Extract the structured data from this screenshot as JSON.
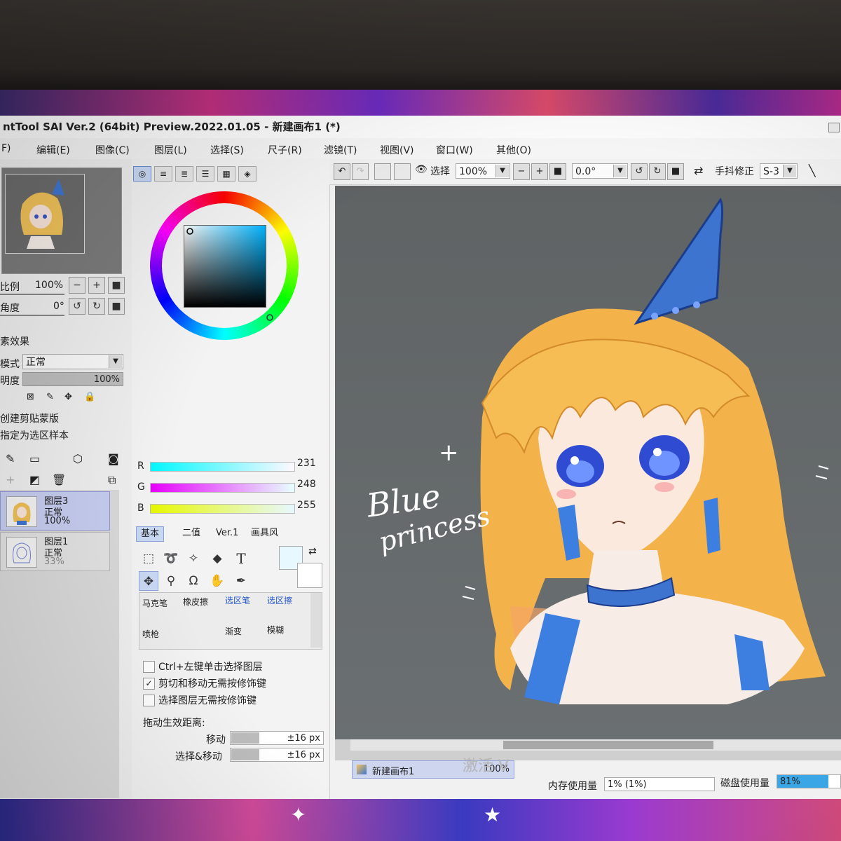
{
  "window": {
    "title": "ntTool SAI Ver.2 (64bit) Preview.2022.01.05 - 新建画布1 (*)"
  },
  "menu": [
    "F)",
    "编辑(E)",
    "图像(C)",
    "图层(L)",
    "选择(S)",
    "尺子(R)",
    "滤镜(T)",
    "视图(V)",
    "窗口(W)",
    "其他(O)"
  ],
  "navigator": {
    "scale_label": "比例",
    "scale_value": "100%",
    "angle_label": "角度",
    "angle_value": "0°"
  },
  "layer_panel": {
    "effect_label": "素效果",
    "mode_label": "模式",
    "mode_value": "正常",
    "opacity_label": "明度",
    "opacity_value": "100%",
    "opacity_fraction": 1.0,
    "clip_label": "创建剪贴蒙版",
    "selection_sample_label": "指定为选区样本",
    "layers": [
      {
        "name": "图层3",
        "mode": "正常",
        "opacity": "100%"
      },
      {
        "name": "图层1",
        "mode": "正常",
        "opacity": "33%"
      }
    ]
  },
  "color": {
    "r_label": "R",
    "g_label": "G",
    "b_label": "B",
    "r_value": "231",
    "g_value": "248",
    "b_value": "255",
    "current_color": "#e7f8ff"
  },
  "tool_modes": [
    "基本",
    "二值",
    "Ver.1",
    "画具风"
  ],
  "brushes": [
    "马克笔",
    "橡皮擦",
    "选区笔",
    "选区擦",
    "喷枪",
    "渐变",
    "模糊"
  ],
  "options": {
    "ctrl_click_label": "Ctrl+左键单击选择图层",
    "ctrl_click_checked": false,
    "cut_move_label": "剪切和移动无需按修饰键",
    "cut_move_checked": true,
    "select_layer_label": "选择图层无需按修饰键",
    "select_layer_checked": false,
    "drag_distance_label": "拖动生效距离:",
    "move_label": "移动",
    "move_value": "±16 px",
    "select_move_label": "选择&移动",
    "select_move_value": "±16 px"
  },
  "toolbar": {
    "selection_label": "选择",
    "zoom_value": "100%",
    "angle_value": "0.0°",
    "stabilizer_label": "手抖修正",
    "stabilizer_value": "S-3"
  },
  "artwork": {
    "text_line1": "Blue",
    "text_line2": "princess"
  },
  "status": {
    "doc_name": "新建画布1",
    "doc_zoom": "100%",
    "memory_label": "内存使用量",
    "memory_value": "1% (1%)",
    "disk_label": "磁盘使用量",
    "disk_value": "81%",
    "disk_fraction": 0.81,
    "watermark": "激活 V"
  }
}
